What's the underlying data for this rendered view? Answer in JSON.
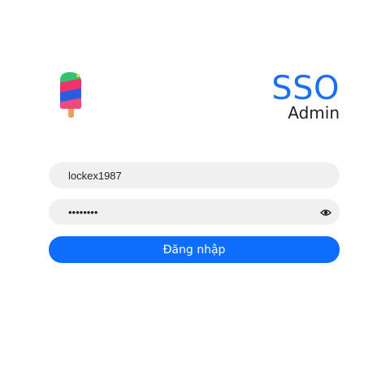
{
  "brand": {
    "title": "SSO",
    "subtitle": "Admin",
    "logo_icon": "popsicle-icon"
  },
  "login": {
    "username_value": "lockex1987",
    "password_value": "lockex19",
    "password_toggle_icon": "eye-icon",
    "submit_label": "Đăng nhập"
  },
  "colors": {
    "accent": "#0d6efd",
    "brand_title": "#1a6ff0",
    "field_bg": "#f0f0f0"
  }
}
